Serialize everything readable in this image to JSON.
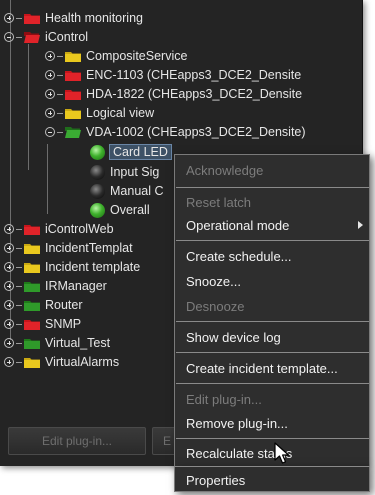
{
  "tree": {
    "items": [
      {
        "label": "Health monitoring",
        "icon": "red-folder-icon"
      },
      {
        "label": "iControl",
        "icon": "red-folder-open-icon"
      },
      {
        "label": "CompositeService",
        "icon": "yellow-folder-icon"
      },
      {
        "label": "ENC-1103 (CHEapps3_DCE2_Densite",
        "icon": "red-folder-icon"
      },
      {
        "label": "HDA-1822 (CHEapps3_DCE2_Densite",
        "icon": "red-folder-icon"
      },
      {
        "label": "Logical view",
        "icon": "yellow-folder-icon"
      },
      {
        "label": "VDA-1002 (CHEapps3_DCE2_Densite)",
        "icon": "green-folder-open-icon"
      },
      {
        "label": "Card LED",
        "icon": "green-led-icon"
      },
      {
        "label": "Input Sig",
        "icon": "dark-led-icon"
      },
      {
        "label": "Manual C",
        "icon": "dark-led-icon"
      },
      {
        "label": "Overall",
        "icon": "green-led-icon"
      },
      {
        "label": "iControlWeb",
        "icon": "red-folder-icon"
      },
      {
        "label": "IncidentTemplat",
        "icon": "yellow-folder-icon"
      },
      {
        "label": "Incident template",
        "icon": "yellow-folder-icon"
      },
      {
        "label": "IRManager",
        "icon": "green-folder-icon"
      },
      {
        "label": "Router",
        "icon": "green-folder-icon"
      },
      {
        "label": "SNMP",
        "icon": "red-folder-icon"
      },
      {
        "label": "Virtual_Test",
        "icon": "green-folder-icon"
      },
      {
        "label": "VirtualAlarms",
        "icon": "yellow-folder-icon"
      }
    ],
    "buttons": {
      "edit_plugin": "Edit plug-in...",
      "second": "E"
    }
  },
  "menu": {
    "acknowledge": "Acknowledge",
    "reset_latch": "Reset latch",
    "operational_mode": "Operational mode",
    "create_schedule": "Create schedule...",
    "snooze": "Snooze...",
    "desnooze": "Desnooze",
    "show_device_log": "Show device log",
    "create_incident_template": "Create incident template...",
    "edit_plugin": "Edit plug-in...",
    "remove_plugin": "Remove plug-in...",
    "recalculate_status": "Recalculate status",
    "properties": "Properties"
  },
  "colors": {
    "folder_red": "#c8151b",
    "folder_yellow": "#e2c21a",
    "folder_green": "#2f9a2a",
    "panel_bg": "#242424",
    "menu_bg": "#2e2e2e"
  }
}
